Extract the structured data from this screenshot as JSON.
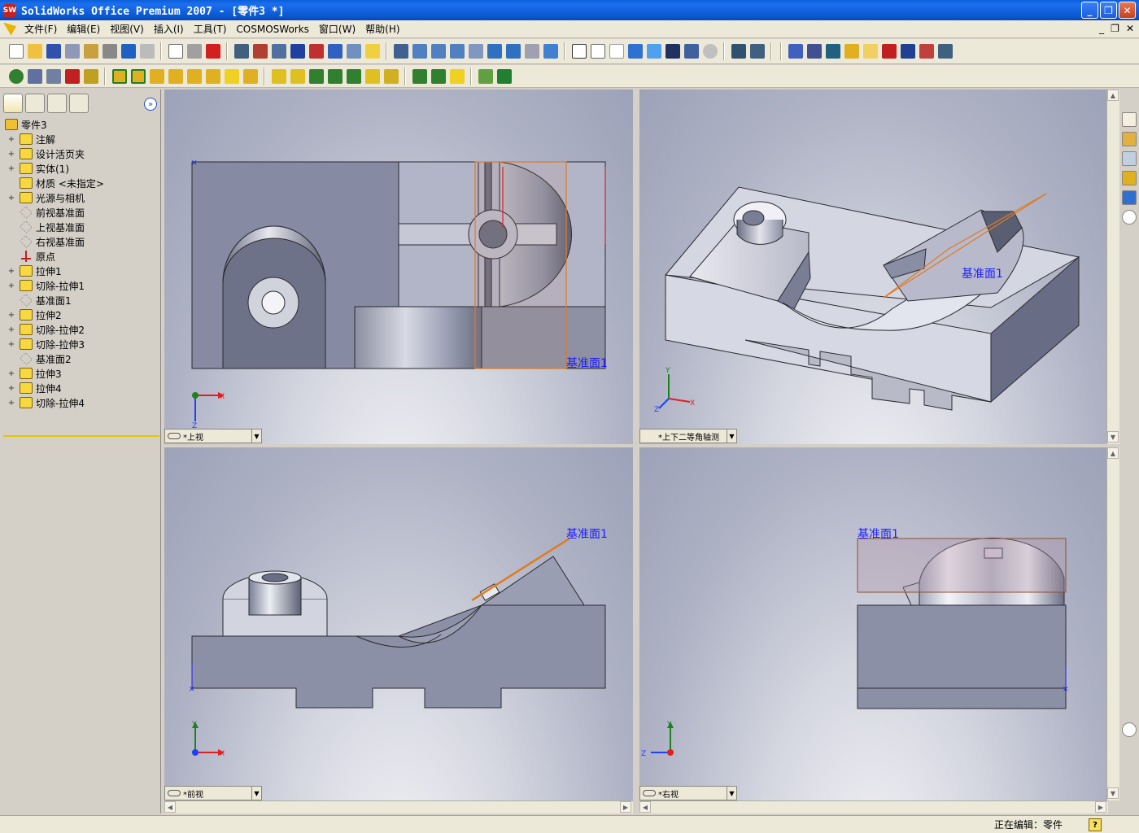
{
  "window": {
    "title": "SolidWorks Office Premium 2007 - [零件3 *]",
    "app_icon_text": "SW"
  },
  "menu": {
    "items": [
      "文件(F)",
      "编辑(E)",
      "视图(V)",
      "插入(I)",
      "工具(T)",
      "COSMOSWorks",
      "窗口(W)",
      "帮助(H)"
    ]
  },
  "feature_tree": {
    "root": "零件3",
    "items": [
      {
        "label": "注解",
        "expandable": true,
        "icon": "annotation-icon"
      },
      {
        "label": "设计活页夹",
        "expandable": true,
        "icon": "design-binder-icon"
      },
      {
        "label": "实体(1)",
        "expandable": true,
        "icon": "solid-body-icon"
      },
      {
        "label": "材质 <未指定>",
        "expandable": false,
        "icon": "material-icon"
      },
      {
        "label": "光源与相机",
        "expandable": true,
        "icon": "lights-camera-icon"
      },
      {
        "label": "前视基准面",
        "expandable": false,
        "icon": "plane-icon"
      },
      {
        "label": "上视基准面",
        "expandable": false,
        "icon": "plane-icon"
      },
      {
        "label": "右视基准面",
        "expandable": false,
        "icon": "plane-icon"
      },
      {
        "label": "原点",
        "expandable": false,
        "icon": "origin-icon"
      },
      {
        "label": "拉伸1",
        "expandable": true,
        "icon": "extrude-icon"
      },
      {
        "label": "切除-拉伸1",
        "expandable": true,
        "icon": "cut-extrude-icon"
      },
      {
        "label": "基准面1",
        "expandable": false,
        "icon": "plane-icon"
      },
      {
        "label": "拉伸2",
        "expandable": true,
        "icon": "extrude-icon"
      },
      {
        "label": "切除-拉伸2",
        "expandable": true,
        "icon": "cut-extrude-icon"
      },
      {
        "label": "切除-拉伸3",
        "expandable": true,
        "icon": "cut-extrude-icon"
      },
      {
        "label": "基准面2",
        "expandable": false,
        "icon": "plane-icon"
      },
      {
        "label": "拉伸3",
        "expandable": true,
        "icon": "extrude-icon"
      },
      {
        "label": "拉伸4",
        "expandable": true,
        "icon": "extrude-icon"
      },
      {
        "label": "切除-拉伸4",
        "expandable": true,
        "icon": "cut-extrude-icon"
      }
    ]
  },
  "viewports": {
    "top_left": {
      "view_name": "*上视",
      "plane_label": "基准面1",
      "axes": [
        "X",
        "Z"
      ]
    },
    "top_right": {
      "view_name": "*上下二等角轴测",
      "plane_label": "基准面1",
      "axes": [
        "Y",
        "X",
        "Z"
      ]
    },
    "bottom_left": {
      "view_name": "*前视",
      "plane_label": "基准面1",
      "axes": [
        "Y",
        "X"
      ]
    },
    "bottom_right": {
      "view_name": "*右视",
      "plane_label": "基准面1",
      "axes": [
        "Y",
        "Z"
      ]
    }
  },
  "status_bar": {
    "text": "正在编辑：零件",
    "help": "?"
  },
  "colors": {
    "model_face": "#8a8ea6",
    "model_edge": "#2a2a30",
    "plane_outline": "#e07a20",
    "plane_label": "#1c1cff",
    "titlebar": "#0a5fd8"
  }
}
